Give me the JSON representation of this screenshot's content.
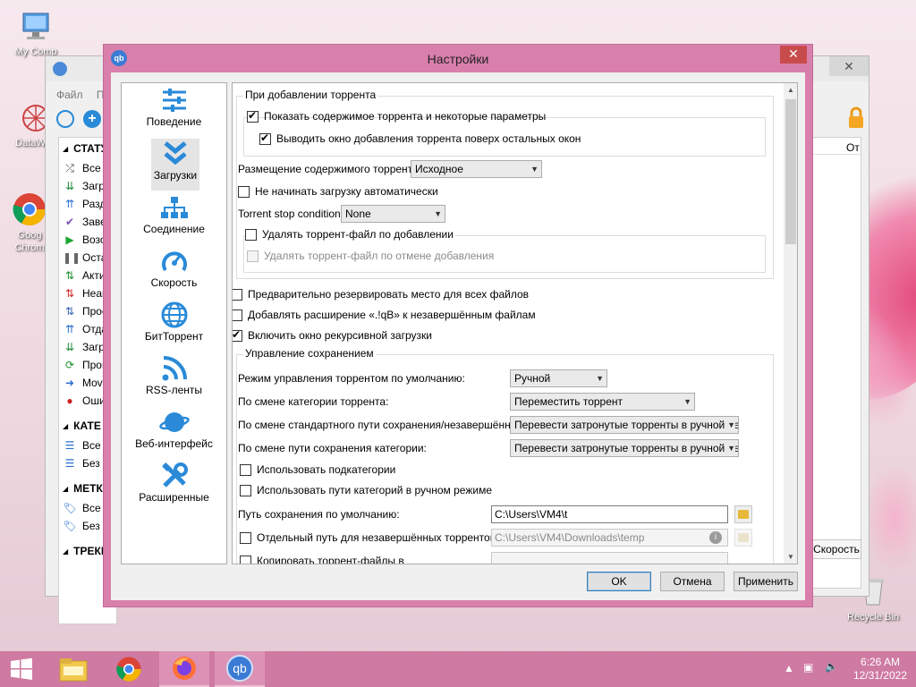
{
  "desktop": {
    "icons": [
      {
        "label": "My Comp",
        "icon": "computer-icon"
      },
      {
        "label": "DataWag",
        "icon": "datawag-icon"
      },
      {
        "label": "Goog Chrom",
        "icon": "chrome-icon"
      }
    ],
    "recycle_bin": "Recycle Bin"
  },
  "main_window": {
    "menu": [
      "Файл",
      "П"
    ],
    "status_header": "СТАТУ",
    "status_items": [
      {
        "label": "Все (",
        "icon": "shuffle-icon",
        "color": "#333"
      },
      {
        "label": "Загру",
        "icon": "download-icon",
        "color": "#1b8a3a"
      },
      {
        "label": "Разд",
        "icon": "upload-icon",
        "color": "#2a6fd0"
      },
      {
        "label": "Заве",
        "icon": "check-icon",
        "color": "#7a4fb8"
      },
      {
        "label": "Возо",
        "icon": "play-icon",
        "color": "#1aa530"
      },
      {
        "label": "Оста",
        "icon": "pause-icon",
        "color": "#666"
      },
      {
        "label": "Акти",
        "icon": "swap-icon",
        "color": "#1a8f2a"
      },
      {
        "label": "Неак",
        "icon": "swap-icon",
        "color": "#d02020"
      },
      {
        "label": "Прос",
        "icon": "swap-icon",
        "color": "#3060b0"
      },
      {
        "label": "Отда",
        "icon": "upload-icon",
        "color": "#2a6fd0"
      },
      {
        "label": "Загр",
        "icon": "download-icon",
        "color": "#1b8a3a"
      },
      {
        "label": "Пров",
        "icon": "refresh-icon",
        "color": "#1a8f2a"
      },
      {
        "label": "Movi",
        "icon": "move-icon",
        "color": "#2a6fd0"
      },
      {
        "label": "Оши",
        "icon": "error-icon",
        "color": "#d02020"
      }
    ],
    "categories_header": "КАТЕ",
    "category_items": [
      {
        "label": "Все ("
      },
      {
        "label": "Без к"
      }
    ],
    "tags_header": "МЕТКИ",
    "tag_items": [
      {
        "label": "Все ("
      },
      {
        "label": "Без м"
      }
    ],
    "trackers_header": "ТРЕКЕ",
    "column_header": "От",
    "speed_button": "Скорость"
  },
  "dialog": {
    "title": "Настройки",
    "app_icon": "qb",
    "categories": [
      {
        "label": "Поведение",
        "icon": "sliders-icon"
      },
      {
        "label": "Загрузки",
        "icon": "double-chevron-down-icon",
        "selected": true
      },
      {
        "label": "Соединение",
        "icon": "network-icon"
      },
      {
        "label": "Скорость",
        "icon": "speedometer-icon"
      },
      {
        "label": "БитТоррент",
        "icon": "globe-icon"
      },
      {
        "label": "RSS-ленты",
        "icon": "rss-icon"
      },
      {
        "label": "Веб-интерфейс",
        "icon": "planet-icon"
      },
      {
        "label": "Расширенные",
        "icon": "tools-icon"
      }
    ],
    "when_adding": {
      "group_label": "При добавлении торрента",
      "show_contents": {
        "label": "Показать содержимое торрента и некоторые параметры",
        "checked": true
      },
      "bring_to_front": {
        "label": "Выводить окно добавления торрента поверх остальных окон",
        "checked": true
      },
      "layout_label": "Размещение содержимого торрента:",
      "layout_value": "Исходное",
      "no_autostart": {
        "label": "Не начинать загрузку автоматически",
        "checked": false
      },
      "stop_condition_label": "Torrent stop condition:",
      "stop_condition_value": "None",
      "delete_torrent_file": {
        "label": "Удалять торрент-файл по добавлении",
        "checked": false
      },
      "delete_on_cancel": {
        "label": "Удалять торрент-файл по отмене добавления",
        "checked": false,
        "disabled": true
      }
    },
    "preallocate": {
      "label": "Предварительно резервировать место для всех файлов",
      "checked": false
    },
    "append_ext": {
      "label": "Добавлять расширение «.!qB» к незавершённым файлам",
      "checked": false
    },
    "recursive": {
      "label": "Включить окно рекурсивной загрузки",
      "checked": true
    },
    "saving": {
      "group_label": "Управление сохранением",
      "mode_label": "Режим управления торрентом по умолчанию:",
      "mode_value": "Ручной",
      "category_changed_label": "По смене категории торрента:",
      "category_changed_value": "Переместить торрент",
      "default_path_changed_label": "По смене стандартного пути сохранения/незавершённых:",
      "default_path_changed_value": "Перевести затронутые торренты в ручной ре",
      "category_path_changed_label": "По смене пути сохранения категории:",
      "category_path_changed_value": "Перевести затронутые торренты в ручной ре",
      "use_subcategories": {
        "label": "Использовать подкатегории",
        "checked": false
      },
      "use_category_paths": {
        "label": "Использовать пути категорий в ручном режиме",
        "checked": false
      },
      "default_path_label": "Путь сохранения по умолчанию:",
      "default_path_value": "C:\\Users\\VM4\\t",
      "incomplete_path": {
        "label": "Отдельный путь для незавершённых торрентов:",
        "checked": false
      },
      "incomplete_path_value": "C:\\Users\\VM4\\Downloads\\temp",
      "copy_torrents": {
        "label": "Копировать торрент-файлы в",
        "checked": false
      }
    },
    "buttons": {
      "ok": "OK",
      "cancel": "Отмена",
      "apply": "Применить"
    }
  },
  "taskbar": {
    "time": "6:26 AM",
    "date": "12/31/2022",
    "apps": [
      "windows-start-icon",
      "file-explorer-icon",
      "chrome-icon",
      "firefox-icon",
      "qbittorrent-icon"
    ]
  },
  "colors": {
    "accent": "#d97fab",
    "taskbar": "#cf7aa2",
    "icon_blue": "#2a8ad8"
  }
}
